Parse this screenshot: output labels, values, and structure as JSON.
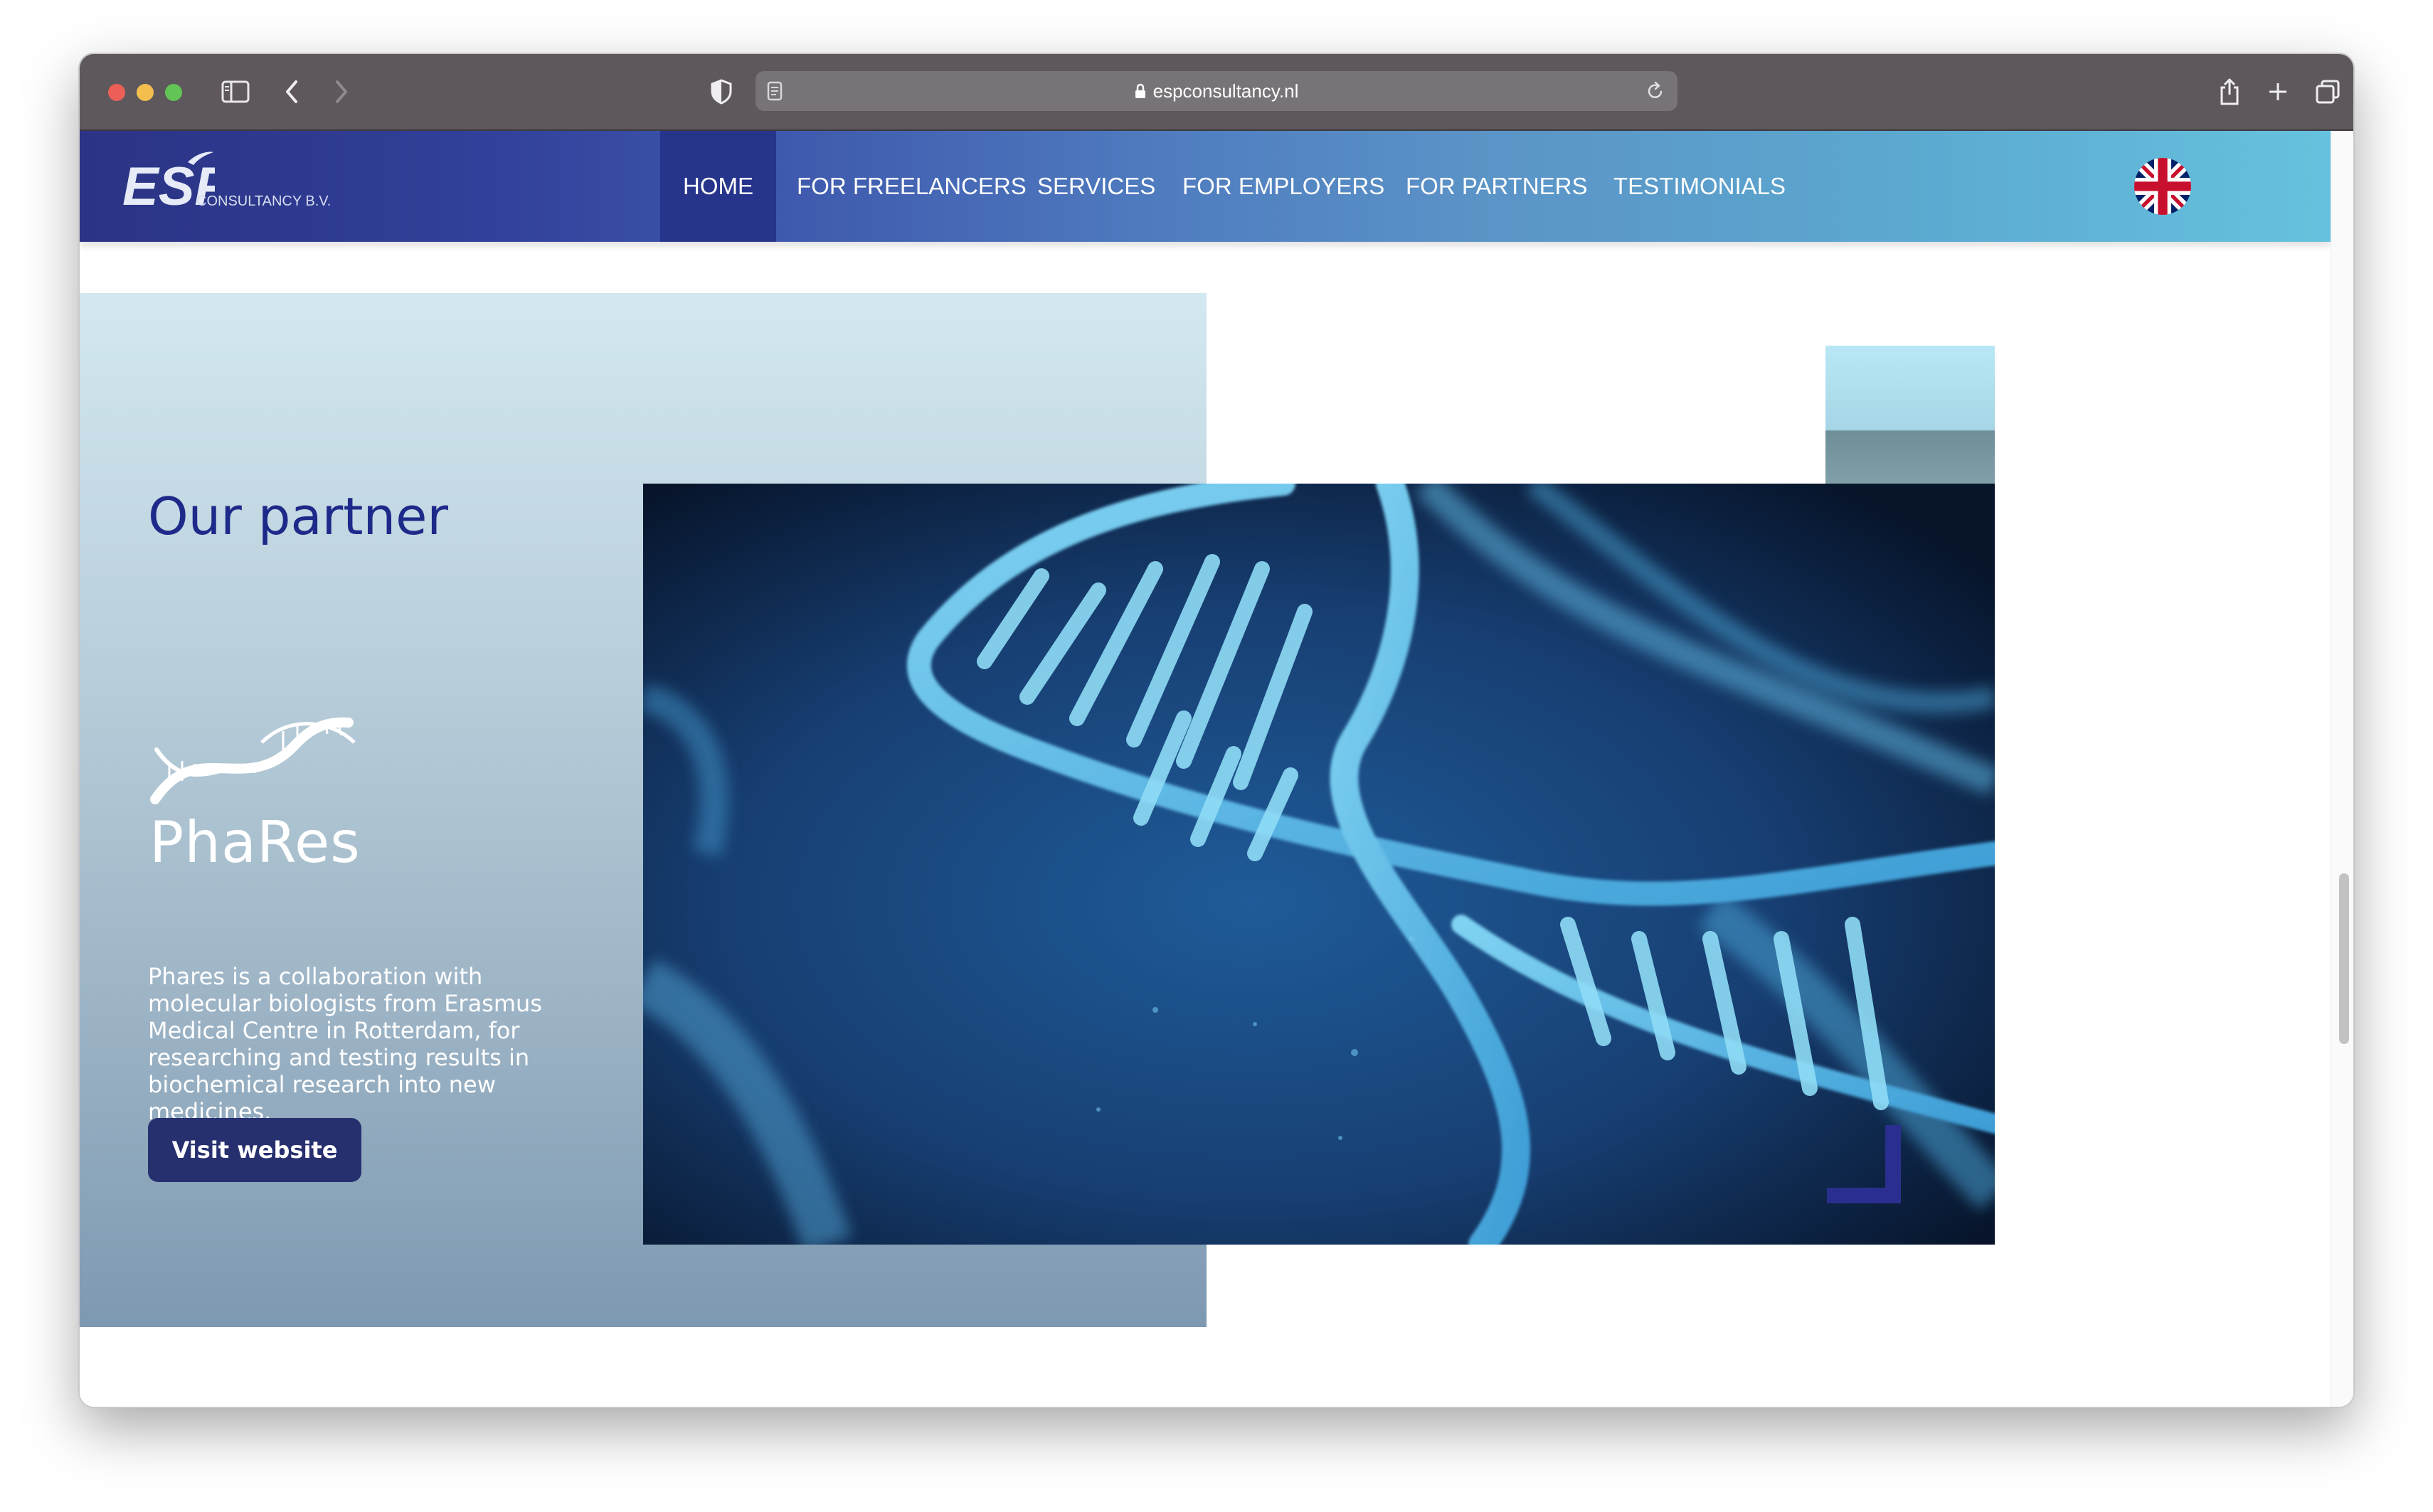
{
  "browser": {
    "url": "espconsultancy.nl"
  },
  "site": {
    "logo": {
      "mark": "ESP",
      "sub": "CONSULTANCY B.V."
    },
    "nav": [
      {
        "label": "HOME",
        "active": true
      },
      {
        "label": "FOR FREELANCERS",
        "active": false
      },
      {
        "label": "SERVICES",
        "active": false
      },
      {
        "label": "FOR EMPLOYERS",
        "active": false
      },
      {
        "label": "FOR PARTNERS",
        "active": false
      },
      {
        "label": "TESTIMONIALS",
        "active": false
      }
    ],
    "language_flag": "uk-flag-icon"
  },
  "partner": {
    "heading": "Our partner",
    "logo_name": "PhaRes",
    "description": "Phares is a collaboration with molecular biologists from Erasmus Medical Centre in Rotterdam, for researching and testing results in biochemical research into new medicines.",
    "button_label": "Visit website"
  },
  "colors": {
    "nav_start": "#2b3384",
    "nav_end": "#66c2de",
    "heading": "#1e2a8a",
    "button": "#27306f",
    "accent": "#2a2f8f"
  }
}
